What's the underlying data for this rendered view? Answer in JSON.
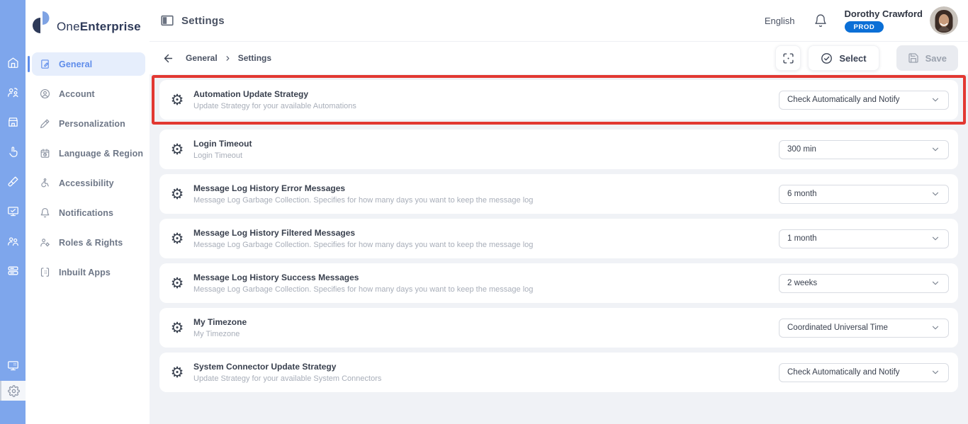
{
  "brand": {
    "name_regular": "One",
    "name_bold": "Enterprise"
  },
  "rail": {
    "icons": [
      "home",
      "users-sync",
      "marketplace",
      "interaction",
      "design",
      "monitor-analytics",
      "user-groups",
      "storage",
      "remote-desktop",
      "settings"
    ],
    "active_icon": "settings",
    "color": "#7EA6EC"
  },
  "sidebar": {
    "items": [
      {
        "label": "General",
        "active": true
      },
      {
        "label": "Account",
        "active": false
      },
      {
        "label": "Personalization",
        "active": false
      },
      {
        "label": "Language & Region",
        "active": false
      },
      {
        "label": "Accessibility",
        "active": false
      },
      {
        "label": "Notifications",
        "active": false
      },
      {
        "label": "Roles & Rights",
        "active": false
      },
      {
        "label": "Inbuilt Apps",
        "active": false
      }
    ]
  },
  "header": {
    "title": "Settings",
    "language": "English",
    "user": {
      "name": "Dorothy Crawford",
      "env_badge": "PROD"
    }
  },
  "toolbar": {
    "breadcrumb": [
      "General",
      "Settings"
    ],
    "select_label": "Select",
    "save_label": "Save",
    "save_disabled": true
  },
  "settings": {
    "rows": [
      {
        "title": "Automation Update Strategy",
        "description": "Update Strategy for your available Automations",
        "value": "Check Automatically and Notify",
        "highlighted": true
      },
      {
        "title": "Login Timeout",
        "description": "Login Timeout",
        "value": "300 min"
      },
      {
        "title": "Message Log History Error Messages",
        "description": "Message Log Garbage Collection. Specifies for how many days you want to keep the message log",
        "value": "6 month"
      },
      {
        "title": "Message Log History Filtered Messages",
        "description": "Message Log Garbage Collection. Specifies for how many days you want to keep the message log",
        "value": "1 month"
      },
      {
        "title": "Message Log History Success Messages",
        "description": "Message Log Garbage Collection. Specifies for how many days you want to keep the message log",
        "value": "2 weeks"
      },
      {
        "title": "My Timezone",
        "description": "My Timezone",
        "value": "Coordinated Universal Time"
      },
      {
        "title": "System Connector Update Strategy",
        "description": "Update Strategy for your available System Connectors",
        "value": "Check Automatically and Notify"
      }
    ]
  },
  "colors": {
    "accent": "#5E8CEA",
    "rail": "#7EA6EC",
    "badge": "#0B6FD6",
    "highlight": "#E23832",
    "content_bg": "#F0F2F6"
  }
}
